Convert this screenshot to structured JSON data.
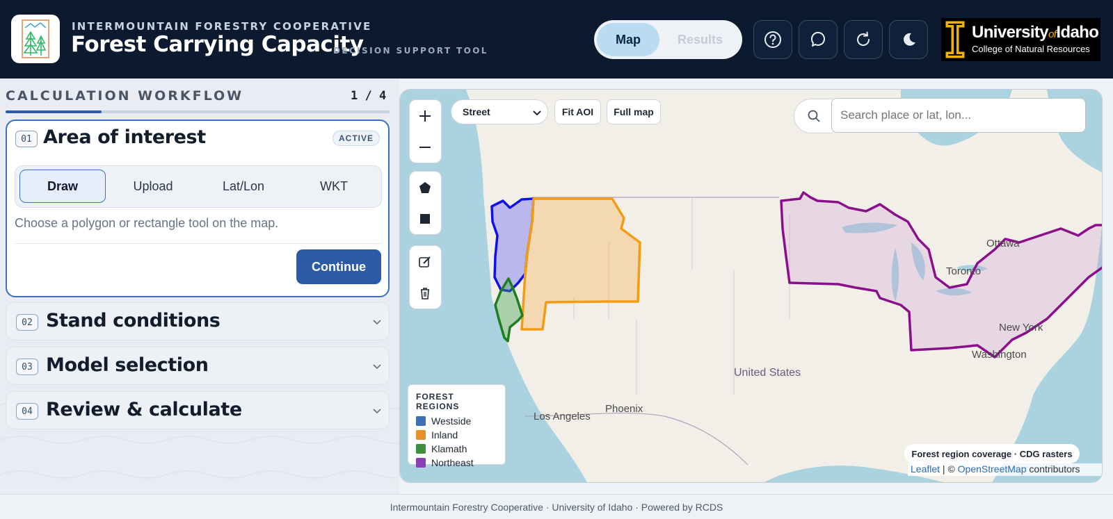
{
  "header": {
    "kicker": "INTERMOUNTAIN FORESTRY COOPERATIVE",
    "title": "Forest Carrying Capacity",
    "subtitle": "DECISION SUPPORT TOOL",
    "view_toggle": {
      "map": "Map",
      "results": "Results",
      "active": "Map"
    },
    "icons": [
      "help-icon",
      "chat-reset-icon",
      "refresh-icon",
      "dark-mode-icon"
    ],
    "partner_logo": {
      "name": "University",
      "of": "of",
      "name2": "Idaho",
      "college": "College of Natural Resources"
    }
  },
  "workflow": {
    "title": "CALCULATION WORKFLOW",
    "progress_text": "1 / 4",
    "progress_fraction": 0.25,
    "steps": [
      {
        "num": "01",
        "title": "Area of interest",
        "badge": "ACTIVE",
        "tabs": [
          "Draw",
          "Upload",
          "Lat/Lon",
          "WKT"
        ],
        "active_tab": "Draw",
        "hint": "Choose a polygon or rectangle tool on the map.",
        "continue_label": "Continue"
      },
      {
        "num": "02",
        "title": "Stand conditions"
      },
      {
        "num": "03",
        "title": "Model selection"
      },
      {
        "num": "04",
        "title": "Review & calculate"
      }
    ]
  },
  "map": {
    "basemap_selected": "Street",
    "buttons": {
      "fit_aoi": "Fit AOI",
      "full_map": "Full map"
    },
    "search_placeholder": "Search place or lat, lon...",
    "legend": {
      "title": "FOREST REGIONS",
      "items": [
        {
          "label": "Westside",
          "color": "#3f6fb5"
        },
        {
          "label": "Inland",
          "color": "#e8902a"
        },
        {
          "label": "Klamath",
          "color": "#3e8f3e"
        },
        {
          "label": "Northeast",
          "color": "#8a3fb5"
        }
      ]
    },
    "place_labels": {
      "ottawa": "Ottawa",
      "toronto": "Toronto",
      "new_york": "New York",
      "washington": "Washington",
      "united_states": "United States",
      "phoenix": "Phoenix",
      "los_angeles": "Los Angeles"
    },
    "coverage_note": "Forest region coverage · CDG rasters",
    "attribution": {
      "leaflet": "Leaflet",
      "sep": " | © ",
      "osm": "OpenStreetMap",
      "tail": " contributors"
    }
  },
  "footer": "Intermountain Forestry Cooperative · University of Idaho · Powered by RCDS"
}
